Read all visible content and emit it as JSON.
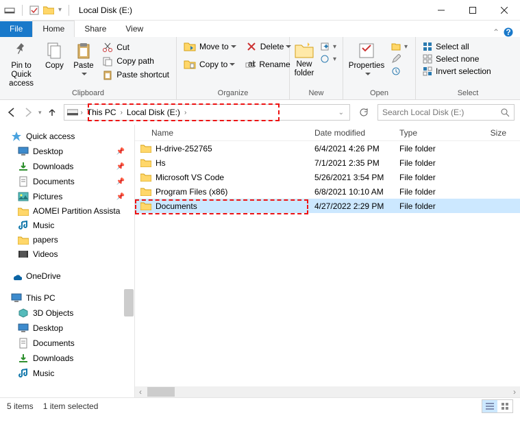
{
  "window": {
    "title": "Local Disk (E:)"
  },
  "tabs": {
    "file": "File",
    "home": "Home",
    "share": "Share",
    "view": "View"
  },
  "ribbon": {
    "clipboard": {
      "label": "Clipboard",
      "pin": "Pin to Quick access",
      "copy": "Copy",
      "paste": "Paste",
      "cut": "Cut",
      "copy_path": "Copy path",
      "paste_shortcut": "Paste shortcut"
    },
    "organize": {
      "label": "Organize",
      "move_to": "Move to",
      "copy_to": "Copy to",
      "delete": "Delete",
      "rename": "Rename"
    },
    "new_group": {
      "label": "New",
      "new_folder": "New folder"
    },
    "open_group": {
      "label": "Open",
      "properties": "Properties"
    },
    "select": {
      "label": "Select",
      "select_all": "Select all",
      "select_none": "Select none",
      "invert": "Invert selection"
    }
  },
  "breadcrumb": {
    "this_pc": "This PC",
    "drive": "Local Disk (E:)"
  },
  "search": {
    "placeholder": "Search Local Disk (E:)"
  },
  "sidebar": {
    "quick_access": "Quick access",
    "items": [
      {
        "label": "Desktop",
        "pinned": true
      },
      {
        "label": "Downloads",
        "pinned": true
      },
      {
        "label": "Documents",
        "pinned": true
      },
      {
        "label": "Pictures",
        "pinned": true
      },
      {
        "label": "AOMEI Partition Assista",
        "pinned": false
      },
      {
        "label": "Music",
        "pinned": false
      },
      {
        "label": "papers",
        "pinned": false
      },
      {
        "label": "Videos",
        "pinned": false
      }
    ],
    "onedrive": "OneDrive",
    "this_pc": "This PC",
    "this_pc_items": [
      {
        "label": "3D Objects"
      },
      {
        "label": "Desktop"
      },
      {
        "label": "Documents"
      },
      {
        "label": "Downloads"
      },
      {
        "label": "Music"
      }
    ]
  },
  "columns": {
    "name": "Name",
    "date": "Date modified",
    "type": "Type",
    "size": "Size"
  },
  "rows": [
    {
      "name": "H-drive-252765",
      "date": "6/4/2021 4:26 PM",
      "type": "File folder"
    },
    {
      "name": "Hs",
      "date": "7/1/2021 2:35 PM",
      "type": "File folder"
    },
    {
      "name": "Microsoft VS Code",
      "date": "5/26/2021 3:54 PM",
      "type": "File folder"
    },
    {
      "name": "Program Files (x86)",
      "date": "6/8/2021 10:10 AM",
      "type": "File folder"
    },
    {
      "name": "Documents",
      "date": "4/27/2022 2:29 PM",
      "type": "File folder",
      "selected": true
    }
  ],
  "status": {
    "count": "5 items",
    "selection": "1 item selected"
  }
}
